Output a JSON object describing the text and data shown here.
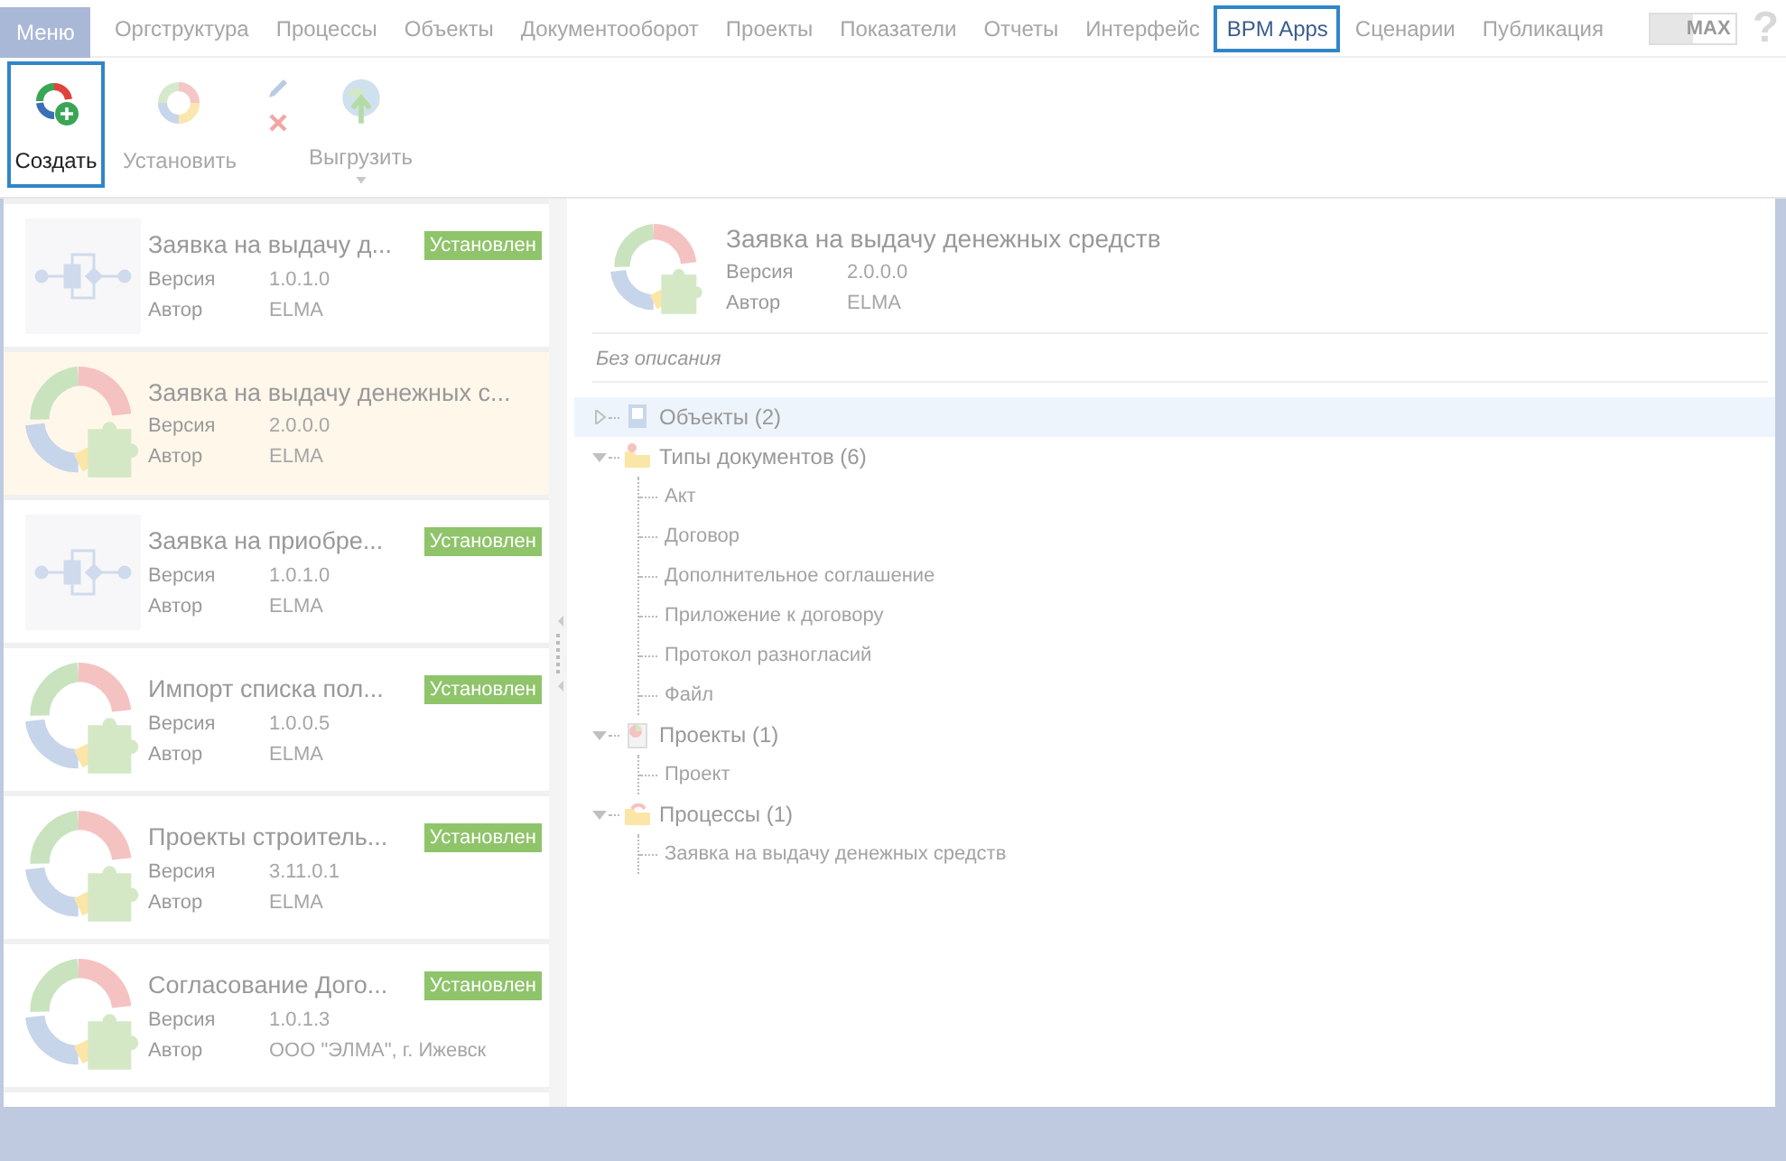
{
  "menu_bar": {
    "tabs": [
      {
        "label": "Меню",
        "kind": "menu",
        "selected": false
      },
      {
        "label": "Оргструктура",
        "kind": "tab",
        "selected": false
      },
      {
        "label": "Процессы",
        "kind": "tab",
        "selected": false
      },
      {
        "label": "Объекты",
        "kind": "tab",
        "selected": false
      },
      {
        "label": "Документооборот",
        "kind": "tab",
        "selected": false
      },
      {
        "label": "Проекты",
        "kind": "tab",
        "selected": false
      },
      {
        "label": "Показатели",
        "kind": "tab",
        "selected": false
      },
      {
        "label": "Отчеты",
        "kind": "tab",
        "selected": false
      },
      {
        "label": "Интерфейс",
        "kind": "tab",
        "selected": false
      },
      {
        "label": "BPM Apps",
        "kind": "tab",
        "selected": true
      },
      {
        "label": "Сценарии",
        "kind": "tab",
        "selected": false
      },
      {
        "label": "Публикация",
        "kind": "tab",
        "selected": false
      }
    ],
    "max_toggle": {
      "label": "MAX"
    },
    "help": "?"
  },
  "toolbar": {
    "buttons": [
      {
        "label": "Создать",
        "kind": "create",
        "disabled": false,
        "selected": true
      },
      {
        "label": "Установить",
        "kind": "install",
        "disabled": true,
        "selected": false
      },
      {
        "kind": "edit-delete",
        "disabled": true
      },
      {
        "label": "Выгрузить",
        "kind": "export",
        "disabled": true,
        "selected": false
      }
    ]
  },
  "apps": [
    {
      "title": "Заявка на выдачу д...",
      "kind": "diagram",
      "version_label": "Версия",
      "version": "1.0.1.0",
      "author_label": "Автор",
      "author": "ELMA",
      "status": "Установлен",
      "selected": false
    },
    {
      "title": "Заявка на выдачу денежных с...",
      "kind": "package",
      "version_label": "Версия",
      "version": "2.0.0.0",
      "author_label": "Автор",
      "author": "ELMA",
      "selected": true
    },
    {
      "title": "Заявка на приобре...",
      "kind": "diagram",
      "version_label": "Версия",
      "version": "1.0.1.0",
      "author_label": "Автор",
      "author": "ELMA",
      "status": "Установлен",
      "selected": false
    },
    {
      "title": "Импорт списка пол...",
      "kind": "package",
      "version_label": "Версия",
      "version": "1.0.0.5",
      "author_label": "Автор",
      "author": "ELMA",
      "status": "Установлен",
      "selected": false
    },
    {
      "title": "Проекты строитель...",
      "kind": "package",
      "version_label": "Версия",
      "version": "3.11.0.1",
      "author_label": "Автор",
      "author": "ELMA",
      "status": "Установлен",
      "selected": false
    },
    {
      "title": "Согласование Дого...",
      "kind": "package",
      "version_label": "Версия",
      "version": "1.0.1.3",
      "author_label": "Автор",
      "author": "ООО \"ЭЛМА\", г. Ижевск",
      "status": "Установлен",
      "selected": false
    }
  ],
  "details": {
    "title": "Заявка на выдачу денежных средств",
    "version_label": "Версия",
    "version": "2.0.0.0",
    "author_label": "Автор",
    "author": "ELMA",
    "description": "Без описания",
    "tree": [
      {
        "label": "Объекты (2)",
        "kind": "objects",
        "expanded": false,
        "selected": true
      },
      {
        "label": "Типы документов (6)",
        "kind": "doctypes",
        "expanded": true,
        "selected": false,
        "children": [
          {
            "label": "Акт"
          },
          {
            "label": "Договор"
          },
          {
            "label": "Дополнительное соглашение"
          },
          {
            "label": "Приложение к договору"
          },
          {
            "label": "Протокол разногласий"
          },
          {
            "label": "Файл"
          }
        ]
      },
      {
        "label": "Проекты (1)",
        "kind": "projects",
        "expanded": true,
        "selected": false,
        "children": [
          {
            "label": "Проект"
          }
        ]
      },
      {
        "label": "Процессы (1)",
        "kind": "processes",
        "expanded": true,
        "selected": false,
        "children": [
          {
            "label": "Заявка на выдачу денежных средств"
          }
        ]
      }
    ]
  }
}
